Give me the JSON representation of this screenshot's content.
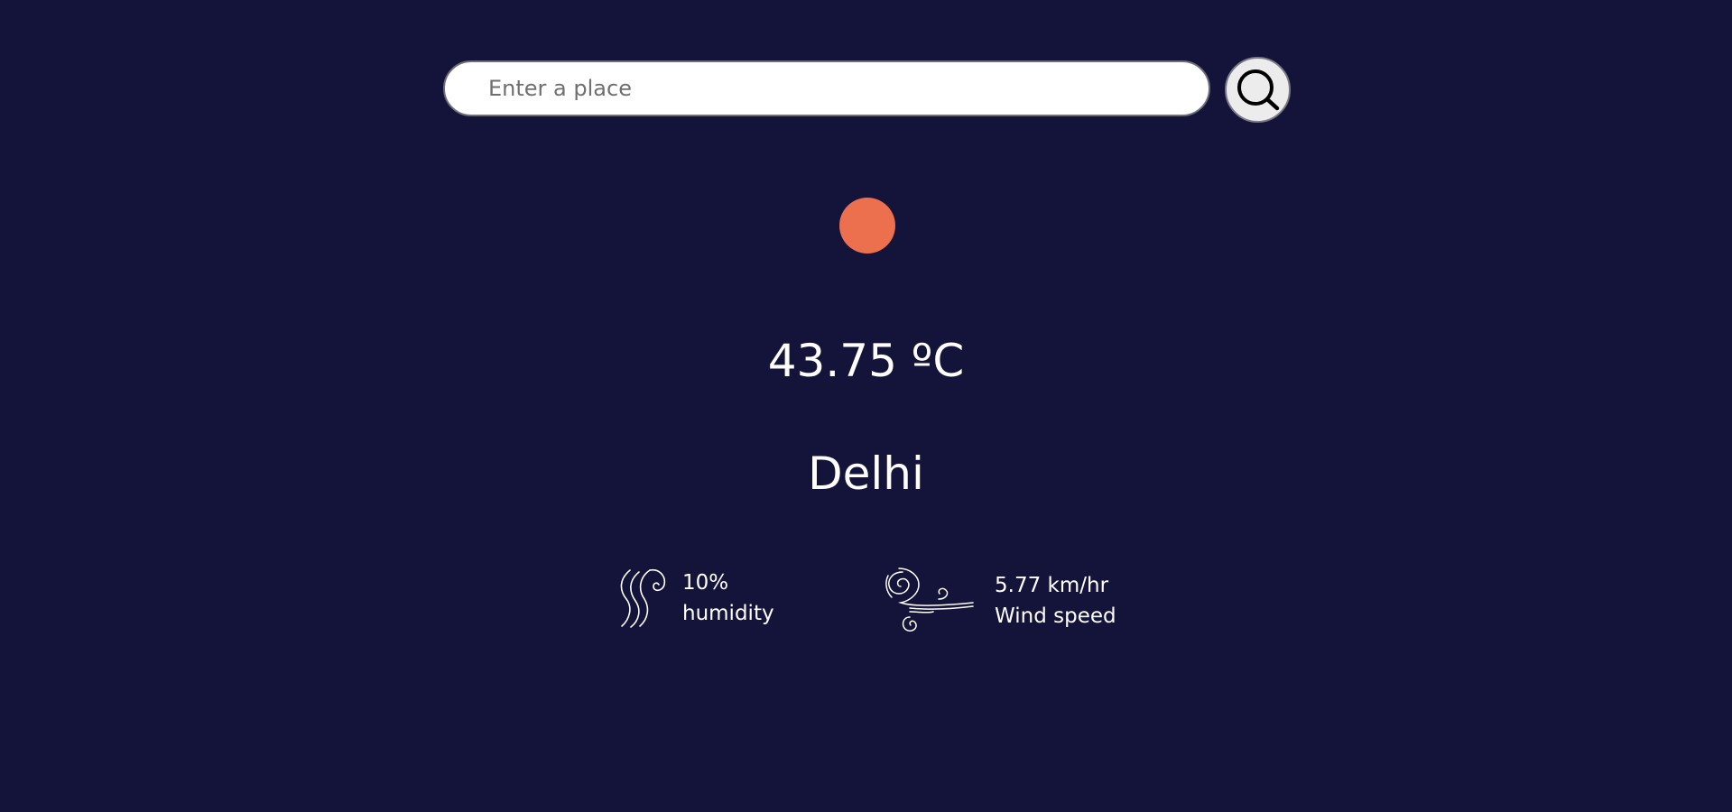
{
  "search": {
    "placeholder": "Enter a place",
    "value": ""
  },
  "weather": {
    "condition_icon": "sun-icon",
    "temperature": "43.75 ºC",
    "city": "Delhi",
    "humidity": {
      "icon": "humidity-icon",
      "value": "10%",
      "label": "humidity"
    },
    "wind": {
      "icon": "wind-icon",
      "value": "5.77 km/hr",
      "label": "Wind speed"
    }
  },
  "colors": {
    "background": "#14143b",
    "sun": "#ec6f4e",
    "text": "#ffffff"
  }
}
